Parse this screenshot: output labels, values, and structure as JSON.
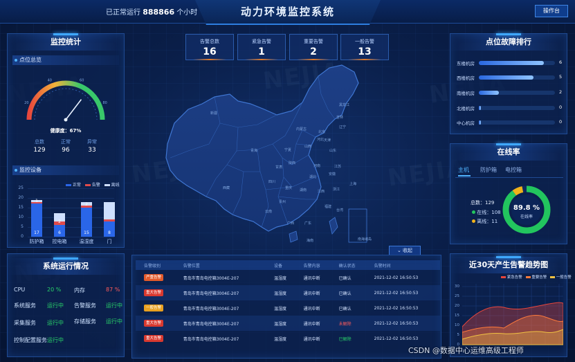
{
  "header": {
    "running_prefix": "已正常运行",
    "running_value": "888866",
    "running_suffix": "个小时",
    "title": "动力环境监控系统",
    "console_button": "操作台"
  },
  "alarms": [
    {
      "label": "告警总数",
      "value": "16"
    },
    {
      "label": "紧急告警",
      "value": "1"
    },
    {
      "label": "重要告警",
      "value": "2"
    },
    {
      "label": "一般告警",
      "value": "13"
    }
  ],
  "left_stats": {
    "panel_title": "监控统计",
    "overview_title": "点位总览",
    "gauge": {
      "ticks": [
        "0",
        "10",
        "20",
        "30",
        "40",
        "50",
        "60",
        "70",
        "80",
        "90",
        "100"
      ],
      "health_label": "健康度：67%",
      "value": 67
    },
    "counts": [
      {
        "label": "总数",
        "value": "129"
      },
      {
        "label": "正常",
        "value": "96"
      },
      {
        "label": "异常",
        "value": "33"
      }
    ],
    "device_title": "监控设备",
    "legend": [
      {
        "label": "正常",
        "color": "#2a66e8"
      },
      {
        "label": "告警",
        "color": "#e04b4b"
      },
      {
        "label": "离线",
        "color": "#cfe0ff"
      }
    ]
  },
  "chart_data": [
    {
      "type": "bar",
      "stacked": true,
      "categories": [
        "防护箱",
        "控电箱",
        "温湿度",
        "门"
      ],
      "series": [
        {
          "name": "正常",
          "values": [
            17,
            6,
            15,
            8
          ]
        },
        {
          "name": "告警",
          "values": [
            1,
            2,
            1,
            1
          ]
        },
        {
          "name": "离线",
          "values": [
            1,
            4,
            2,
            9
          ]
        }
      ],
      "bar_labels": [
        [
          "17",
          "1"
        ],
        [
          "6",
          "2"
        ],
        [
          "15",
          "2"
        ],
        [
          "8"
        ]
      ],
      "yticks": [
        "0",
        "5",
        "10",
        "15",
        "20",
        "25"
      ],
      "ylim": [
        0,
        25
      ]
    },
    {
      "type": "area",
      "title": "近30天产生告警趋势图",
      "series": [
        {
          "name": "紧急告警",
          "color": "#e8463c"
        },
        {
          "name": "重要告警",
          "color": "#ff7a3c"
        },
        {
          "name": "一般告警",
          "color": "#f2c242"
        }
      ],
      "yticks": [
        "0",
        "5",
        "10",
        "15",
        "20",
        "25",
        "30"
      ],
      "ylim": [
        0,
        30
      ]
    }
  ],
  "system": {
    "title": "系统运行情况",
    "rows": [
      [
        {
          "k": "CPU",
          "v": "20 %",
          "c": "#29d36a"
        },
        {
          "k": "内存",
          "v": "87 %",
          "c": "#ff5b5b"
        }
      ],
      [
        {
          "k": "系统服务",
          "v": "运行中",
          "c": "#29d36a"
        },
        {
          "k": "告警服务",
          "v": "运行中",
          "c": "#29d36a"
        }
      ],
      [
        {
          "k": "采集服务",
          "v": "运行中",
          "c": "#29d36a"
        },
        {
          "k": "存储服务",
          "v": "运行中",
          "c": "#29d36a"
        }
      ],
      [
        {
          "k": "控制配置服务",
          "v": "运行中",
          "c": "#29d36a"
        }
      ]
    ]
  },
  "map": {
    "provinces": [
      "新疆",
      "西藏",
      "青海",
      "甘肃",
      "内蒙古",
      "黑龙江",
      "吉林",
      "辽宁",
      "宁夏",
      "陕西",
      "山西",
      "河北",
      "北京",
      "天津",
      "山东",
      "河南",
      "四川",
      "湖北",
      "安徽",
      "江苏",
      "上海",
      "重庆",
      "湖南",
      "江西",
      "浙江",
      "贵州",
      "云南",
      "广西",
      "广东",
      "福建",
      "台湾",
      "海南",
      "南海诸岛"
    ],
    "collapse_label": "收起"
  },
  "table": {
    "headers": [
      "告警级别",
      "告警位置",
      "设备",
      "告警内容",
      "确认状态",
      "告警时间"
    ],
    "rows": [
      {
        "level": "严重告警",
        "color": "#e15a2b",
        "loc": "青岛市青岛电控箱3004E-207",
        "device": "温湿度",
        "content": "通讯中断",
        "status": "已确认",
        "scolor": "#d5e4ff",
        "time": "2021-12-02 16:50:53"
      },
      {
        "level": "重大告警",
        "color": "#d9392f",
        "loc": "青岛市青岛电控箱3004E-207",
        "device": "温湿度",
        "content": "通讯中断",
        "status": "已确认",
        "scolor": "#d5e4ff",
        "time": "2021-12-02 16:50:53"
      },
      {
        "level": "一般告警",
        "color": "#e8a020",
        "loc": "青岛市青岛电控箱3004E-207",
        "device": "温湿度",
        "content": "通讯中断",
        "status": "已确认",
        "scolor": "#d5e4ff",
        "time": "2021-12-02 16:50:53"
      },
      {
        "level": "重大告警",
        "color": "#d9392f",
        "loc": "青岛市青岛电控箱3004E-207",
        "device": "温湿度",
        "content": "通讯中断",
        "status": "未解除",
        "scolor": "#ff5b5b",
        "time": "2021-12-02 16:50:53"
      },
      {
        "level": "重大告警",
        "color": "#d9392f",
        "loc": "青岛市青岛电控箱3004E-207",
        "device": "温湿度",
        "content": "通讯中断",
        "status": "已解除",
        "scolor": "#29d36a",
        "time": "2021-12-02 16:50:53"
      }
    ]
  },
  "ranking": {
    "title": "点位故障排行",
    "items": [
      {
        "label": "东楼机房",
        "value": "6",
        "fraction": 0.85
      },
      {
        "label": "西楼机房",
        "value": "5",
        "fraction": 0.72
      },
      {
        "label": "南楼机房",
        "value": "2",
        "fraction": 0.26
      },
      {
        "label": "北楼机房",
        "value": "0",
        "fraction": 0.03
      },
      {
        "label": "中心机房",
        "value": "0",
        "fraction": 0.03
      }
    ]
  },
  "online": {
    "title": "在线率",
    "tabs": [
      "主机",
      "防护箱",
      "电控箱"
    ],
    "total_label": "总数：129",
    "legend": [
      {
        "label": "在线：108",
        "color": "#22c55e"
      },
      {
        "label": "离线：11",
        "color": "#f0b21a"
      }
    ],
    "rate": "89.8 %",
    "rate_label": "在线率",
    "fraction": 0.898
  },
  "footer": {
    "text": "CSDN @数据中心运维高级工程师"
  }
}
